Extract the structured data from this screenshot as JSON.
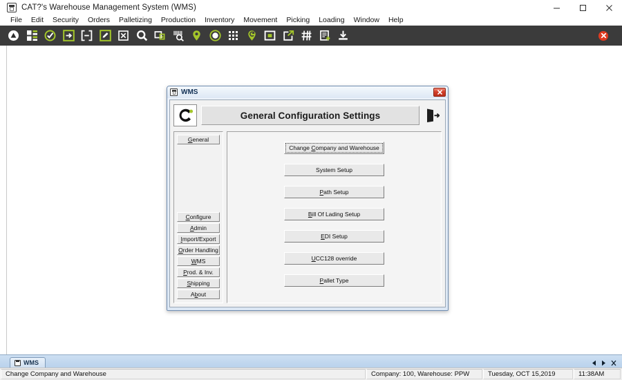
{
  "window": {
    "title": "CAT?'s Warehouse Management System (WMS)",
    "title_icon": "app-window-icon",
    "controls": {
      "minimize": "minimize-icon",
      "maximize": "maximize-icon",
      "close": "close-icon"
    }
  },
  "menubar": {
    "items": [
      {
        "label": "File"
      },
      {
        "label": "Edit"
      },
      {
        "label": "Security"
      },
      {
        "label": "Orders"
      },
      {
        "label": "Palletizing"
      },
      {
        "label": "Production"
      },
      {
        "label": "Inventory"
      },
      {
        "label": "Movement"
      },
      {
        "label": "Picking"
      },
      {
        "label": "Loading"
      },
      {
        "label": "Window"
      },
      {
        "label": "Help"
      }
    ]
  },
  "toolbar": {
    "accent_color": "#a4c62a",
    "background_color": "#3b3b3b",
    "close_color": "#e03a20",
    "icons": [
      {
        "name": "arrow-up-circle-icon"
      },
      {
        "name": "dashboard-grid-icon"
      },
      {
        "name": "check-circle-icon"
      },
      {
        "name": "login-arrow-icon"
      },
      {
        "name": "remove-bracket-icon"
      },
      {
        "name": "edit-pencil-icon"
      },
      {
        "name": "cancel-box-icon"
      },
      {
        "name": "search-icon"
      },
      {
        "name": "copy-pointer-icon"
      },
      {
        "name": "barcode-search-icon"
      },
      {
        "name": "location-pin-icon"
      },
      {
        "name": "circle-filled-icon"
      },
      {
        "name": "grid-dots-icon"
      },
      {
        "name": "refresh-location-icon"
      },
      {
        "name": "square-dot-icon"
      },
      {
        "name": "export-share-icon"
      },
      {
        "name": "hash-grid-icon"
      },
      {
        "name": "document-add-icon"
      },
      {
        "name": "download-icon"
      }
    ],
    "close_button": "toolbar-close-icon"
  },
  "dialog": {
    "titlebar": {
      "icon": "dialog-window-icon",
      "title": "WMS",
      "close": "dialog-close-icon"
    },
    "header": {
      "logo": "company-c-logo-icon",
      "title": "General Configuration Settings",
      "exit_icon": "exit-door-icon"
    },
    "sidebar": {
      "top_items": [
        {
          "label": "General",
          "mnemonic": "G"
        }
      ],
      "bottom_items": [
        {
          "label": "Configure",
          "mnemonic": "C"
        },
        {
          "label": "Admin",
          "mnemonic": "A"
        },
        {
          "label": "Import/Export",
          "mnemonic": "I"
        },
        {
          "label": "Order Handling",
          "mnemonic": "O"
        },
        {
          "label": "WMS",
          "mnemonic": "W"
        },
        {
          "label": "Prod. & Inv.",
          "mnemonic": "P"
        },
        {
          "label": "Shipping",
          "mnemonic": "S"
        },
        {
          "label": "About",
          "mnemonic": "b"
        }
      ]
    },
    "buttons": [
      {
        "label": "Change Company and Warehouse",
        "mnemonic": "C",
        "focused": true
      },
      {
        "label": "System Setup",
        "mnemonic": "",
        "focused": false
      },
      {
        "label": "Path Setup",
        "mnemonic": "P",
        "focused": false
      },
      {
        "label": "Bill Of Lading Setup",
        "mnemonic": "B",
        "focused": false
      },
      {
        "label": "EDI Setup",
        "mnemonic": "E",
        "focused": false
      },
      {
        "label": "UCC128 override",
        "mnemonic": "U",
        "focused": false
      },
      {
        "label": "Pallet Type",
        "mnemonic": "P",
        "focused": false
      }
    ]
  },
  "tabstrip": {
    "tabs": [
      {
        "label": "WMS",
        "icon": "mdi-tab-icon",
        "active": true
      }
    ],
    "nav": {
      "previous": "nav-left-icon",
      "next": "nav-right-icon",
      "close": "nav-close-icon"
    }
  },
  "statusbar": {
    "message": "Change Company and Warehouse",
    "company": "Company: 100, Warehouse: PPW",
    "date": "Tuesday, OCT 15,2019",
    "time": "11:38AM"
  }
}
